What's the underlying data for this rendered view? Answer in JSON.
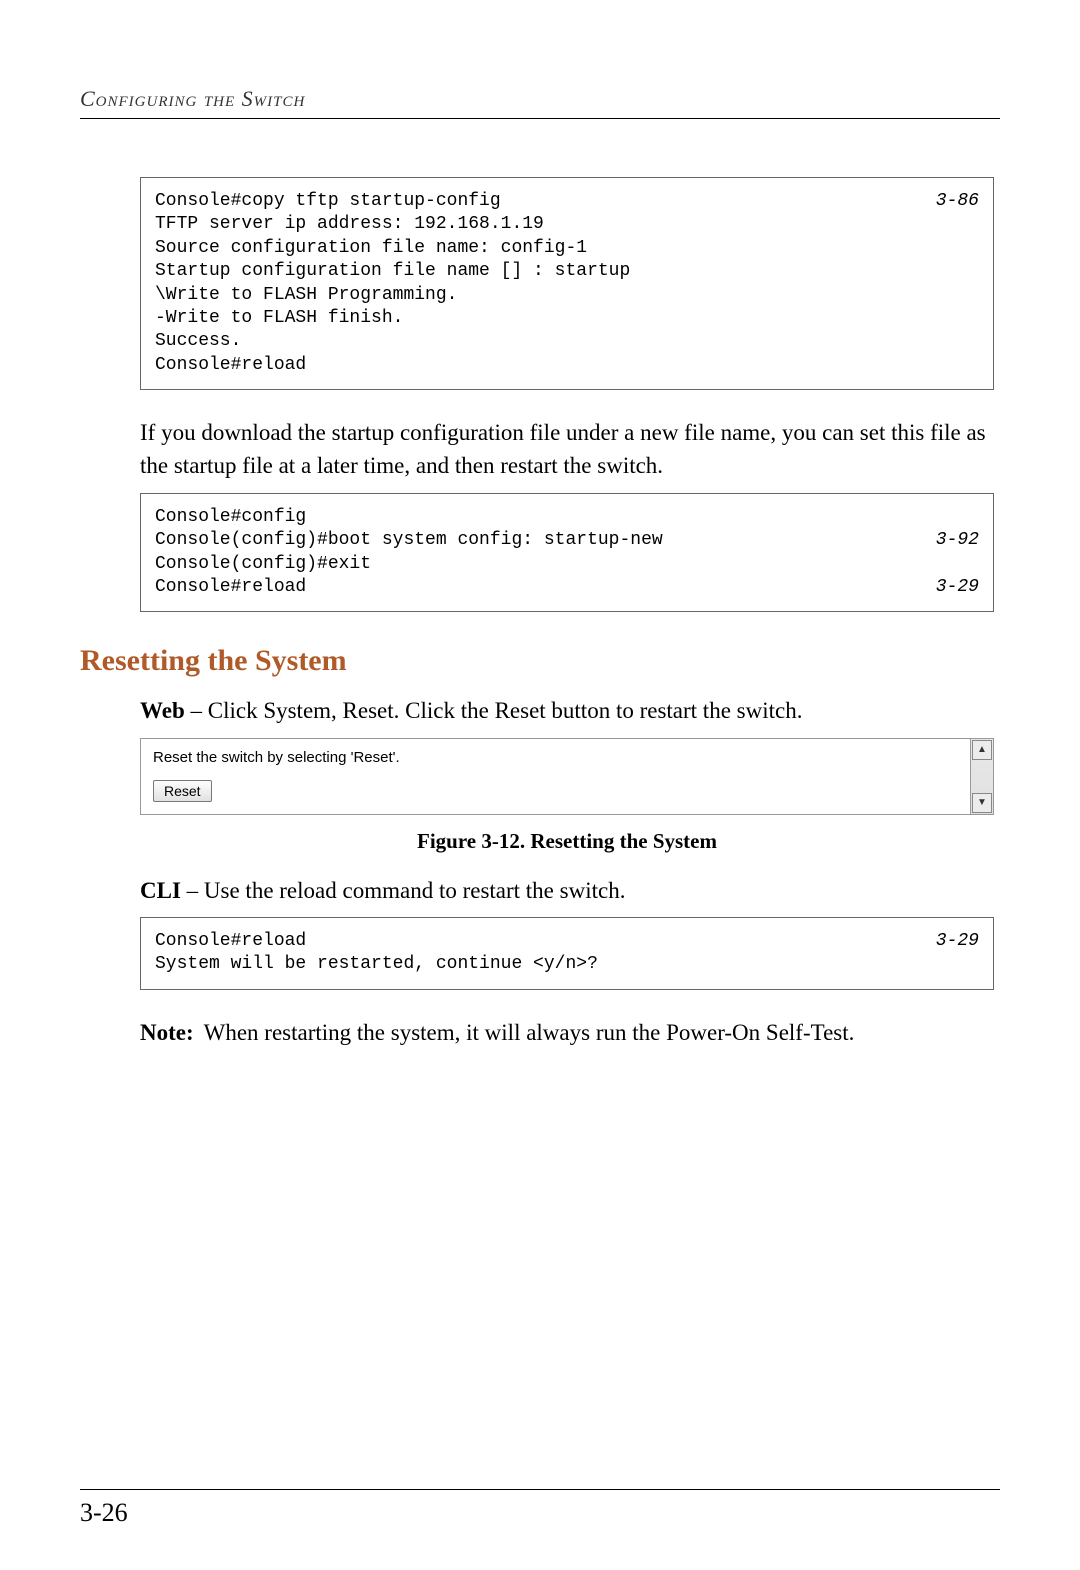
{
  "running_head": "Configuring the Switch",
  "code1": {
    "lines": [
      {
        "text": "Console#copy tftp startup-config",
        "ref": "3-86"
      },
      {
        "text": "TFTP server ip address: 192.168.1.19",
        "ref": ""
      },
      {
        "text": "Source configuration file name: config-1",
        "ref": ""
      },
      {
        "text": "Startup configuration file name [] : startup",
        "ref": ""
      },
      {
        "text": "\\Write to FLASH Programming.",
        "ref": ""
      },
      {
        "text": "-Write to FLASH finish.",
        "ref": ""
      },
      {
        "text": "Success.",
        "ref": ""
      },
      {
        "text": "",
        "ref": ""
      },
      {
        "text": "Console#reload",
        "ref": ""
      }
    ]
  },
  "para1": "If you download the startup configuration file under a new file name, you can set this file as the startup file at a later time, and then restart the switch.",
  "code2": {
    "lines": [
      {
        "text": "Console#config",
        "ref": ""
      },
      {
        "text": "Console(config)#boot system config: startup-new",
        "ref": "3-92"
      },
      {
        "text": "Console(config)#exit",
        "ref": ""
      },
      {
        "text": "Console#reload",
        "ref": "3-29"
      }
    ]
  },
  "section_heading": "Resetting the System",
  "web_line": {
    "label": "Web",
    "text": " – Click System, Reset. Click the Reset button to restart the switch."
  },
  "web_panel": {
    "instruction": "Reset the switch by selecting 'Reset'.",
    "button_label": "Reset"
  },
  "figure_caption": "Figure 3-12.  Resetting the System",
  "cli_line": {
    "label": "CLI",
    "text": " – Use the reload command to restart the switch."
  },
  "code3": {
    "lines": [
      {
        "text": "Console#reload",
        "ref": "3-29"
      },
      {
        "text": "System will be restarted, continue <y/n>?",
        "ref": ""
      }
    ]
  },
  "note": {
    "label": "Note:",
    "text": "When restarting the system, it will always run the Power-On Self-Test."
  },
  "page_number": "3-26"
}
